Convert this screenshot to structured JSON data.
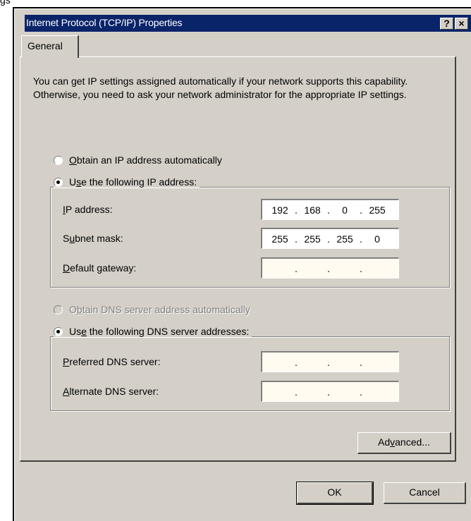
{
  "window": {
    "clip_title": "gs",
    "title": "Internet Protocol (TCP/IP) Properties",
    "help_button": "?",
    "close_button": "×"
  },
  "tabs": [
    {
      "label": "General"
    }
  ],
  "intro_text": "You can get IP settings assigned automatically if your network supports this capability. Otherwise, you need to ask your network administrator for the appropriate IP settings.",
  "ip_section": {
    "auto": {
      "mnemonic": "O",
      "label_rest": "btain an IP address automatically",
      "checked": false
    },
    "manual": {
      "prefix": "U",
      "mnemonic": "s",
      "label_rest": "e the following IP address:",
      "checked": true
    },
    "fields": [
      {
        "mnemonic": "I",
        "label_rest": "P address:",
        "octets": [
          "192",
          "168",
          "0",
          "255"
        ]
      },
      {
        "prefix": "S",
        "mnemonic": "u",
        "label_rest": "bnet mask:",
        "octets": [
          "255",
          "255",
          "255",
          "0"
        ]
      },
      {
        "mnemonic": "D",
        "label_rest": "efault gateway:",
        "octets": [
          "",
          "",
          "",
          ""
        ]
      }
    ]
  },
  "dns_section": {
    "auto": {
      "prefix": "O",
      "mnemonic": "b",
      "label_rest": "tain DNS server address automatically",
      "checked": false,
      "disabled": true
    },
    "manual": {
      "prefix": "Us",
      "mnemonic": "e",
      "label_rest": " the following DNS server addresses:",
      "checked": true
    },
    "fields": [
      {
        "mnemonic": "P",
        "label_rest": "referred DNS server:",
        "octets": [
          "",
          "",
          "",
          ""
        ]
      },
      {
        "mnemonic": "A",
        "label_rest": "lternate DNS server:",
        "octets": [
          "",
          "",
          "",
          ""
        ]
      }
    ]
  },
  "buttons": {
    "advanced": {
      "prefix": "Ad",
      "mnemonic": "v",
      "rest": "anced..."
    },
    "ok": "OK",
    "cancel": "Cancel"
  }
}
